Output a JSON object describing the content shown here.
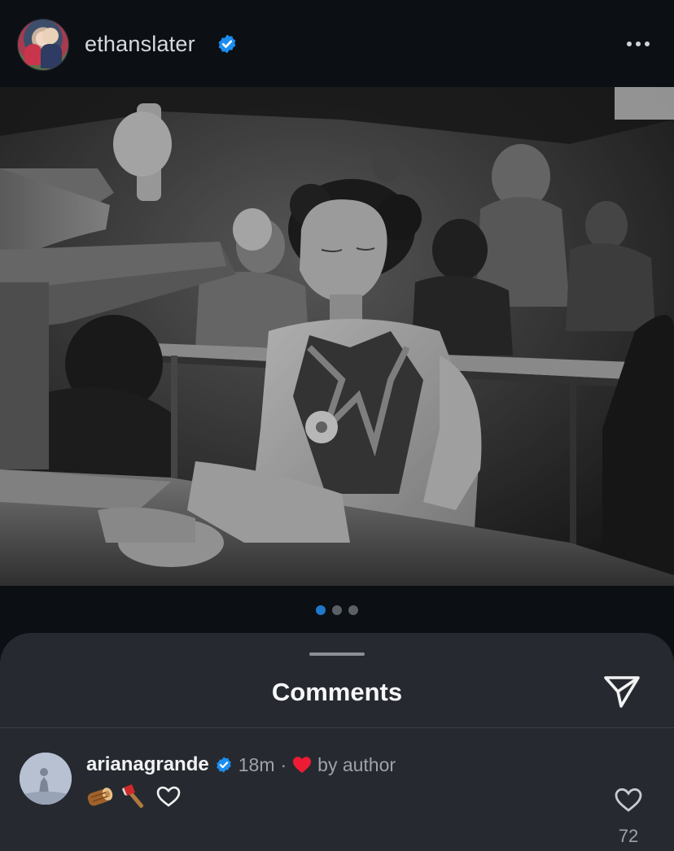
{
  "post": {
    "username": "ethanslater",
    "verified": true,
    "carousel": {
      "total": 3,
      "active_index": 0
    }
  },
  "comments_sheet": {
    "title": "Comments",
    "comments": [
      {
        "username": "ariana​grande",
        "verified": true,
        "time": "18m",
        "separator": "·",
        "liked_by_author_label": "by author",
        "body_icons": [
          "wood-log-emoji",
          "axe-emoji",
          "white-heart-emoji"
        ],
        "like_count": "72"
      }
    ]
  },
  "colors": {
    "background": "#0c1015",
    "sheet": "#262a30",
    "verified_blue": "#1d8ef0",
    "dot_active": "#1f78c9",
    "heart_red": "#ed1c34"
  }
}
